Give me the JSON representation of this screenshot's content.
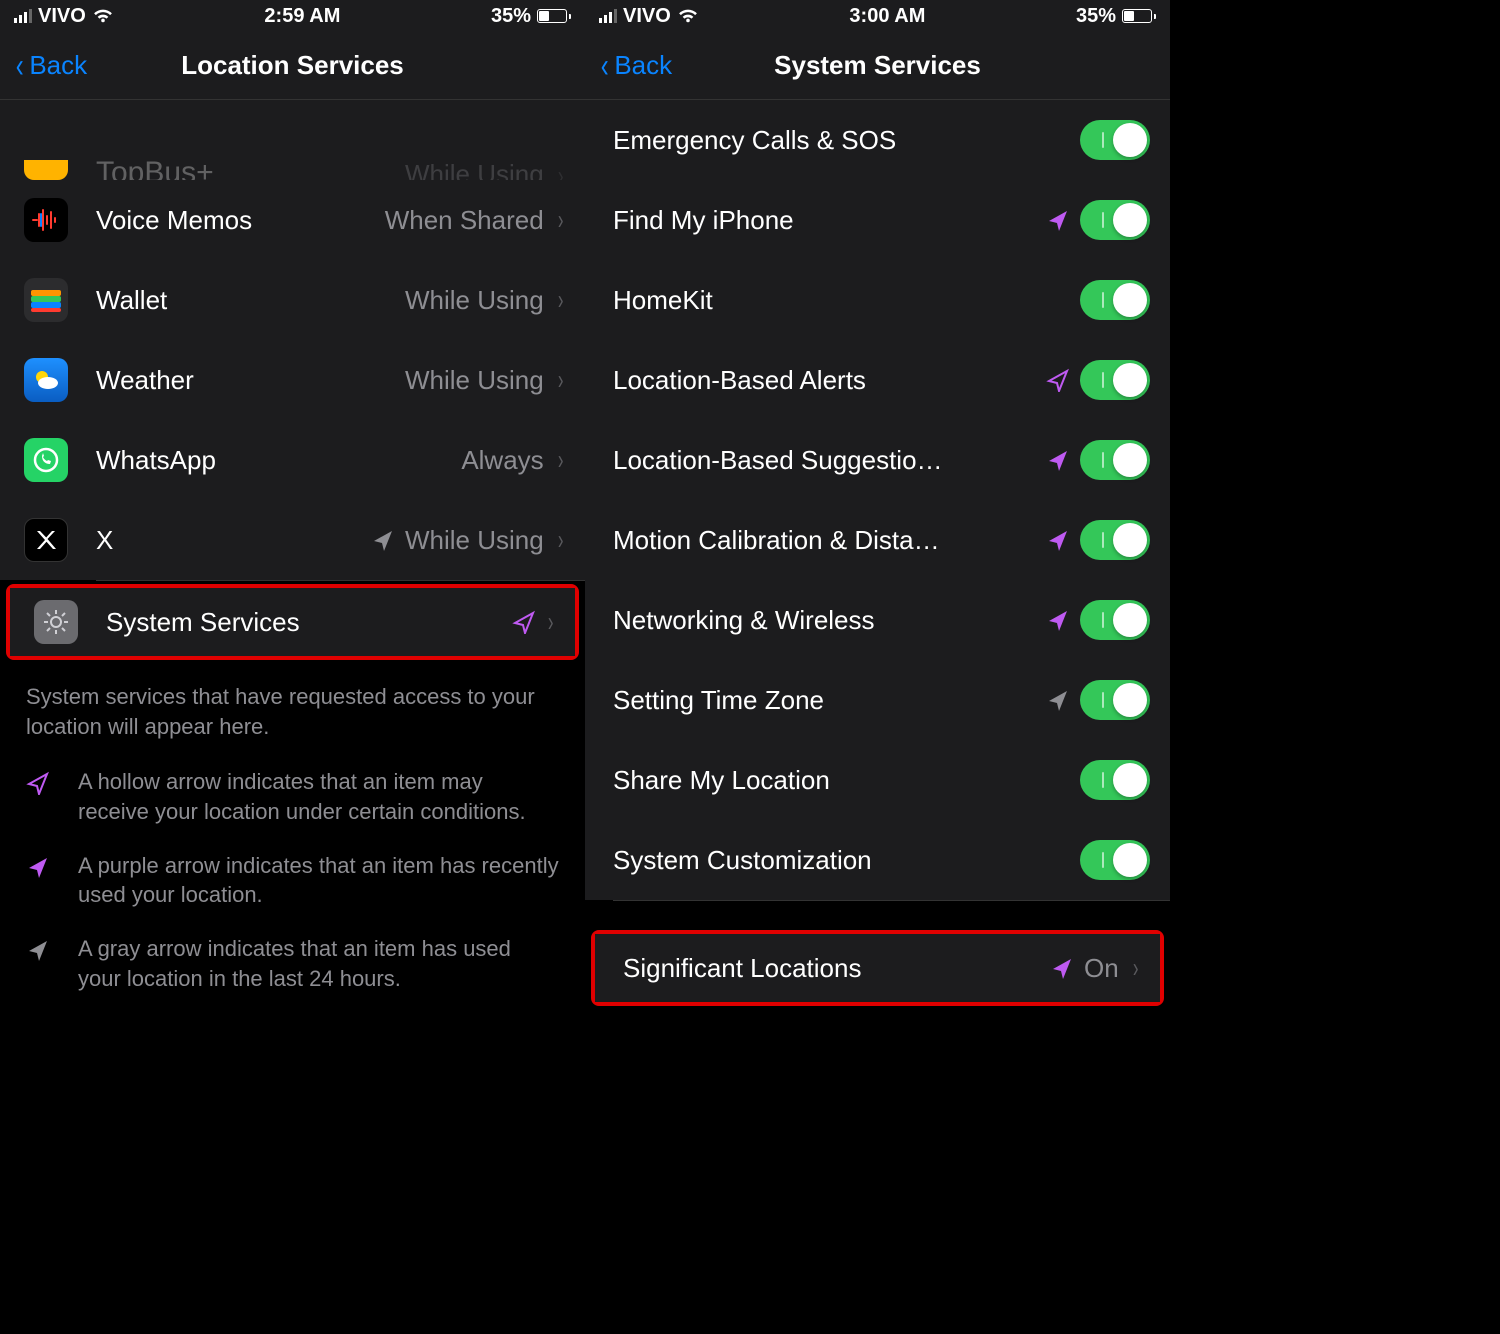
{
  "left": {
    "status": {
      "carrier": "VIVO",
      "time": "2:59 AM",
      "battery_pct": "35%"
    },
    "nav": {
      "back": "Back",
      "title": "Location Services"
    },
    "rows": [
      {
        "label": "TopBus+",
        "value": "While Using",
        "icon_bg": "#ffb300",
        "cut": true
      },
      {
        "label": "Voice Memos",
        "value": "When Shared",
        "icon_bg": "#000"
      },
      {
        "label": "Wallet",
        "value": "While Using",
        "icon_bg": "#2c2c2e"
      },
      {
        "label": "Weather",
        "value": "While Using",
        "icon_bg": "#1e90ff"
      },
      {
        "label": "WhatsApp",
        "value": "Always",
        "icon_bg": "#25d366"
      },
      {
        "label": "X",
        "value": "While Using",
        "icon_bg": "#000",
        "arrow": "gray"
      },
      {
        "label": "System Services",
        "value": "",
        "icon_bg": "#5a5a5e",
        "arrow": "purple-hollow",
        "highlight": true
      }
    ],
    "footer": "System services that have requested access to your location will appear here.",
    "legend": [
      {
        "arrow": "purple-hollow",
        "text": "A hollow arrow indicates that an item may receive your location under certain conditions."
      },
      {
        "arrow": "purple-solid",
        "text": "A purple arrow indicates that an item has recently used your location."
      },
      {
        "arrow": "gray",
        "text": "A gray arrow indicates that an item has used your location in the last 24 hours."
      }
    ]
  },
  "right": {
    "status": {
      "carrier": "VIVO",
      "time": "3:00 AM",
      "battery_pct": "35%"
    },
    "nav": {
      "back": "Back",
      "title": "System Services"
    },
    "rows": [
      {
        "label": "Emergency Calls & SOS",
        "toggle": true
      },
      {
        "label": "Find My iPhone",
        "toggle": true,
        "arrow": "purple-solid"
      },
      {
        "label": "HomeKit",
        "toggle": true
      },
      {
        "label": "Location-Based Alerts",
        "toggle": true,
        "arrow": "purple-hollow"
      },
      {
        "label": "Location-Based Suggestio…",
        "toggle": true,
        "arrow": "purple-solid"
      },
      {
        "label": "Motion Calibration & Dista…",
        "toggle": true,
        "arrow": "purple-solid"
      },
      {
        "label": "Networking & Wireless",
        "toggle": true,
        "arrow": "purple-solid"
      },
      {
        "label": "Setting Time Zone",
        "toggle": true,
        "arrow": "gray"
      },
      {
        "label": "Share My Location",
        "toggle": true
      },
      {
        "label": "System Customization",
        "toggle": true
      }
    ],
    "significant": {
      "label": "Significant Locations",
      "value": "On",
      "arrow": "purple-solid"
    }
  }
}
